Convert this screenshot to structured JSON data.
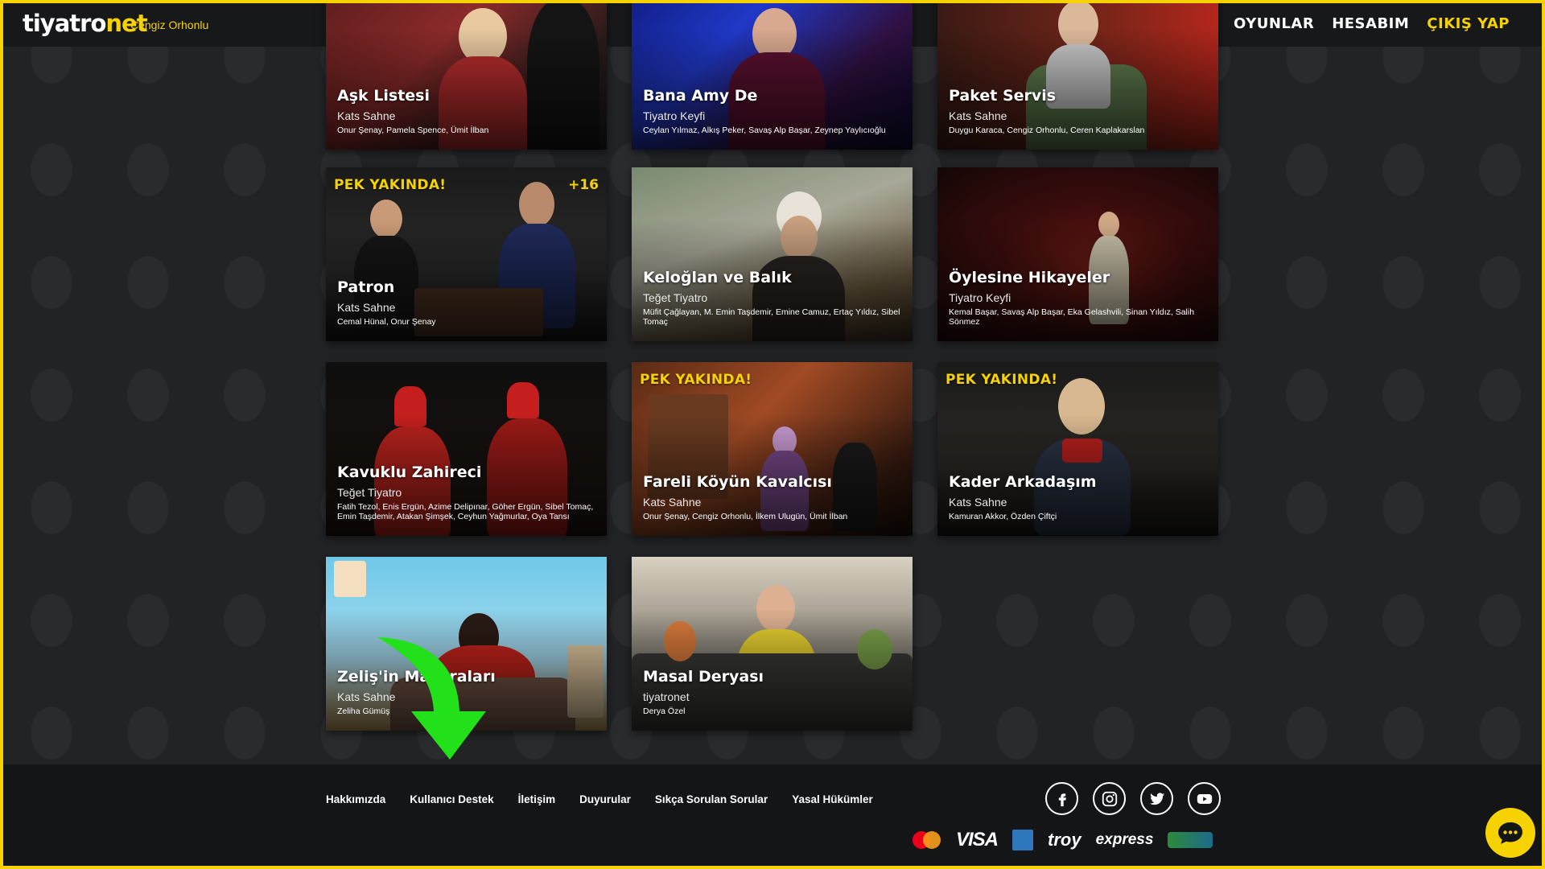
{
  "header": {
    "logo_main": "tiyatro",
    "logo_accent": "net",
    "username": "Cengiz Orhonlu",
    "nav": [
      {
        "label": "OYUNLAR"
      },
      {
        "label": "HESABIM"
      },
      {
        "label": "ÇIKIŞ YAP"
      }
    ]
  },
  "cards": [
    {
      "title": "Aşk Listesi",
      "company": "Kats Sahne",
      "cast": "Onur Şenay, Pamela Spence, Ümit İlban",
      "soon": "",
      "age": ""
    },
    {
      "title": "Bana Amy De",
      "company": "Tiyatro Keyfi",
      "cast": "Ceylan Yılmaz, Alkış Peker, Savaş Alp Başar, Zeynep Yaylıcıoğlu",
      "soon": "",
      "age": ""
    },
    {
      "title": "Paket Servis",
      "company": "Kats Sahne",
      "cast": "Duygu Karaca, Cengiz Orhonlu, Ceren Kaplakarslan",
      "soon": "",
      "age": ""
    },
    {
      "title": "Patron",
      "company": "Kats Sahne",
      "cast": "Cemal Hünal, Onur Şenay",
      "soon": "PEK YAKINDA!",
      "age": "+16"
    },
    {
      "title": "Keloğlan ve Balık",
      "company": "Teğet Tiyatro",
      "cast": "Müfit Çağlayan, M. Emin Taşdemir, Emine Camuz, Ertaç Yıldız, Sibel Tomaç",
      "soon": "",
      "age": ""
    },
    {
      "title": "Öylesine Hikayeler",
      "company": "Tiyatro Keyfi",
      "cast": "Kemal Başar, Savaş Alp Başar, Eka Gelashvili, Sinan Yıldız, Salih Sönmez",
      "soon": "",
      "age": ""
    },
    {
      "title": "Kavuklu Zahireci",
      "company": "Teğet Tiyatro",
      "cast": "Fatih Tezol, Enis Ergün, Azime Delipınar, Göher Ergün, Sibel Tomaç, Emin Taşdemir, Atakan Şimşek, Ceyhun Yağmurlar, Oya Tansı",
      "soon": "",
      "age": ""
    },
    {
      "title": "Fareli Köyün Kavalcısı",
      "company": "Kats Sahne",
      "cast": "Onur Şenay, Cengiz Orhonlu, İlkem Ulugün, Ümit İlban",
      "soon": "PEK YAKINDA!",
      "age": ""
    },
    {
      "title": "Kader Arkadaşım",
      "company": "Kats Sahne",
      "cast": "Kamuran Akkor, Özden Çiftçi",
      "soon": "PEK YAKINDA!",
      "age": ""
    },
    {
      "title": "Zeliş'in Maceraları",
      "company": "Kats Sahne",
      "cast": "Zeliha Gümüş",
      "soon": "",
      "age": ""
    },
    {
      "title": "Masal Deryası",
      "company": "tiyatronet",
      "cast": "Derya Özel",
      "soon": "",
      "age": ""
    }
  ],
  "footer": {
    "links": [
      {
        "label": "Hakkımızda"
      },
      {
        "label": "Kullanıcı Destek"
      },
      {
        "label": "İletişim"
      },
      {
        "label": "Duyurular"
      },
      {
        "label": "Sıkça Sorulan Sorular"
      },
      {
        "label": "Yasal Hükümler"
      }
    ],
    "socials": [
      "facebook-icon",
      "instagram-icon",
      "twitter-icon",
      "youtube-icon"
    ],
    "payments": {
      "visa": "VISA",
      "troy": "troy",
      "express": "express"
    }
  },
  "colors": {
    "accent": "#f6d200",
    "background": "#222325",
    "header": "#17181a",
    "annotation_arrow": "#22e01a"
  }
}
